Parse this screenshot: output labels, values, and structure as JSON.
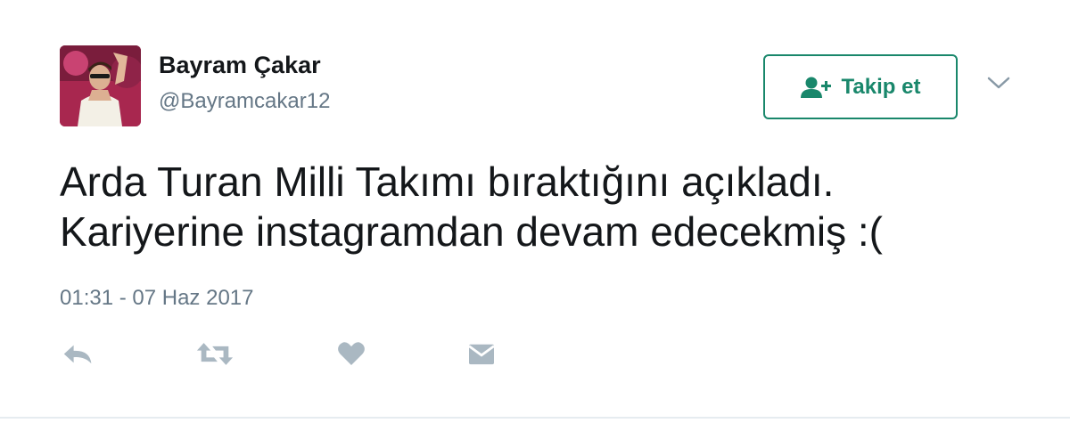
{
  "author": {
    "display_name": "Bayram Çakar",
    "handle": "@Bayramcakar12",
    "avatar_icon": "profile-photo"
  },
  "follow_button": {
    "label": "Takip et",
    "icon": "add-user-icon",
    "color": "#19876b"
  },
  "menu": {
    "icon": "chevron-down-icon"
  },
  "tweet": {
    "lines": [
      "Arda Turan Milli Takımı bıraktığını açıkladı.",
      "Kariyerine instagramdan devam edecekmiş :("
    ],
    "timestamp": "01:31 - 07 Haz 2017"
  },
  "actions": [
    {
      "name": "reply",
      "icon": "reply-icon"
    },
    {
      "name": "retweet",
      "icon": "retweet-icon"
    },
    {
      "name": "like",
      "icon": "heart-icon"
    },
    {
      "name": "direct-message",
      "icon": "envelope-icon"
    }
  ],
  "colors": {
    "text": "#14171a",
    "secondary_text": "#657786",
    "action_icon": "#aab8c2",
    "accent": "#19876b"
  }
}
